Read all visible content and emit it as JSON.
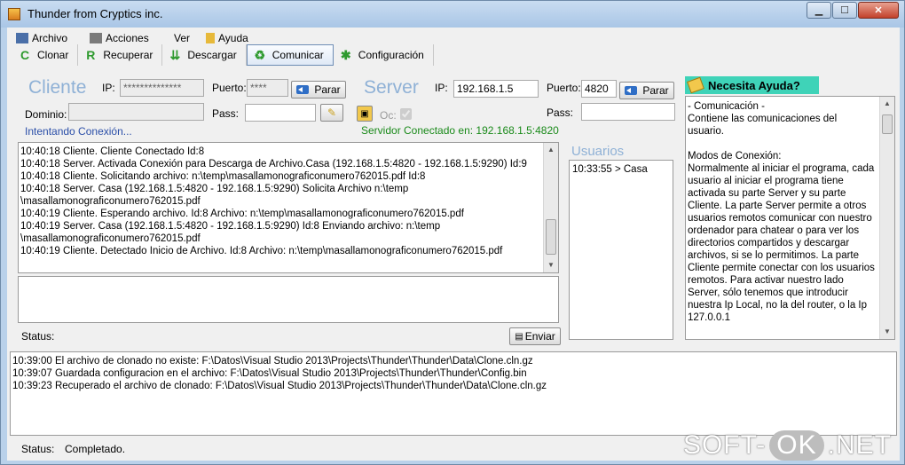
{
  "window": {
    "title": "Thunder from Cryptics inc."
  },
  "menu": [
    "Archivo",
    "Acciones",
    "Ver",
    "Ayuda"
  ],
  "toolbar": [
    "Clonar",
    "Recuperar",
    "Descargar",
    "Comunicar",
    "Configuración"
  ],
  "client": {
    "heading": "Cliente",
    "ip_label": "IP:",
    "ip_value": "**************",
    "port_label": "Puerto:",
    "port_value": "****",
    "stop_label": "Parar",
    "domain_label": "Dominio:",
    "pass_label": "Pass:",
    "status": "Intentando Conexión..."
  },
  "server": {
    "heading": "Server",
    "ip_label": "IP:",
    "ip_value": "192.168.1.5",
    "port_label": "Puerto:",
    "port_value": "4820",
    "stop_label": "Parar",
    "pass_label": "Pass:",
    "oc_label": "Oc:",
    "status": "Servidor Conectado en: 192.168.1.5:4820"
  },
  "log": [
    "10:40:18 Cliente. Cliente Conectado Id:8",
    "10:40:18 Server.  Activada Conexión para Descarga de Archivo.Casa (192.168.1.5:4820 - 192.168.1.5:9290) Id:9",
    "10:40:18 Cliente. Solicitando archivo: n:\\temp\\masallamonograficonumero762015.pdf Id:8",
    "10:40:18 Server.  Casa (192.168.1.5:4820 - 192.168.1.5:9290) Solicita Archivo n:\\temp",
    "\\masallamonograficonumero762015.pdf",
    "10:40:19 Cliente. Esperando archivo. Id:8 Archivo: n:\\temp\\masallamonograficonumero762015.pdf",
    "10:40:19 Server.  Casa (192.168.1.5:4820 - 192.168.1.5:9290) Id:8 Enviando archivo: n:\\temp",
    "\\masallamonograficonumero762015.pdf",
    "10:40:19 Cliente. Detectado Inicio de Archivo. Id:8 Archivo: n:\\temp\\masallamonograficonumero762015.pdf"
  ],
  "chat": {
    "status_label": "Status:",
    "send_label": "Enviar"
  },
  "users": {
    "heading": "Usuarios",
    "items": [
      "10:33:55 > Casa"
    ]
  },
  "help": {
    "title": "Necesita Ayuda?",
    "lines": [
      "- Comunicación -",
      "Contiene las comunicaciones del",
      "usuario.",
      "",
      "Modos de Conexión:",
      "Normalmente al iniciar el programa, cada",
      "usuario al iniciar el programa tiene",
      "activada su parte Server y su parte",
      "Cliente. La parte Server permite a otros",
      "usuarios remotos comunicar con nuestro",
      "ordenador para chatear o para ver los",
      "directorios compartidos y descargar",
      "archivos, si se lo permitimos. La parte",
      "Cliente permite conectar con los usuarios",
      "remotos.  Para activar nuestro lado",
      "Server, sólo tenemos que introducir",
      "nuestra Ip Local, no la del router, o la Ip",
      "127.0.0.1"
    ]
  },
  "bottom_log": [
    "10:39:00 El archivo de clonado no existe: F:\\Datos\\Visual Studio 2013\\Projects\\Thunder\\Thunder\\Data\\Clone.cln.gz",
    "10:39:07 Guardada configuracion en el archivo: F:\\Datos\\Visual Studio 2013\\Projects\\Thunder\\Thunder\\Config.bin",
    "10:39:23 Recuperado el archivo de clonado: F:\\Datos\\Visual Studio 2013\\Projects\\Thunder\\Thunder\\Data\\Clone.cln.gz"
  ],
  "statusbar": {
    "label": "Status:",
    "value": "Completado."
  },
  "watermark": {
    "left": "SOFT-",
    "mid": "OK",
    "right": ".NET"
  },
  "colors": {
    "heading": "#8fb1d6",
    "status_client": "#2b4fa8",
    "status_server": "#1a8a1a",
    "help_title_bg": "#3fd3b8"
  }
}
